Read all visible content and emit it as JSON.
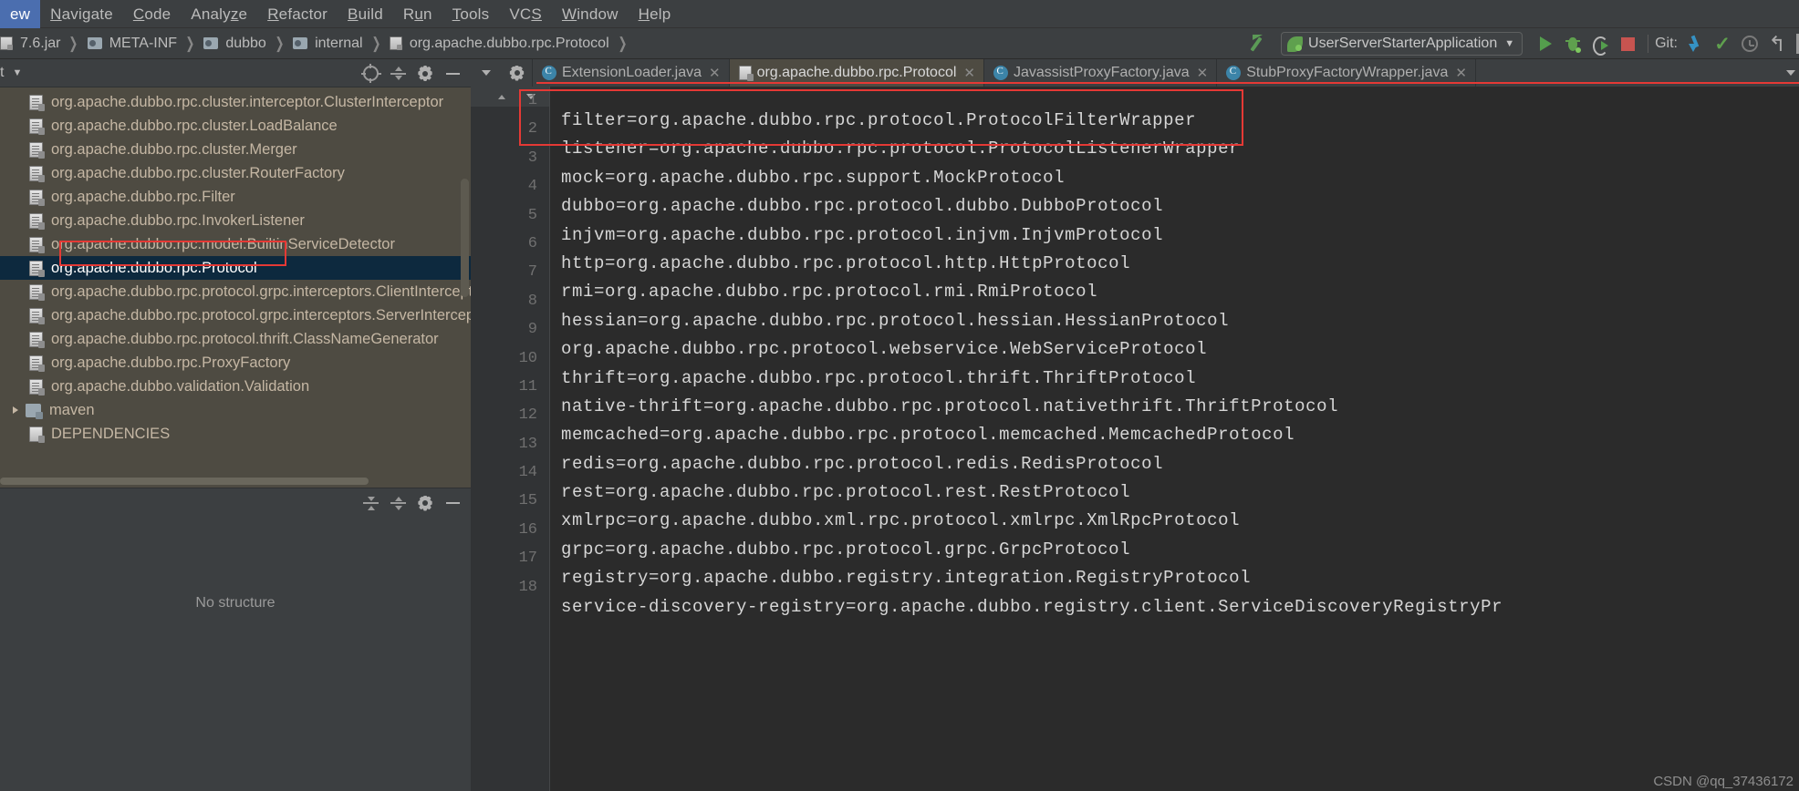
{
  "menu": {
    "items": [
      {
        "label": "ew",
        "mnemonic": ""
      },
      {
        "label": "Navigate",
        "mnemonic": "N"
      },
      {
        "label": "Code",
        "mnemonic": "C"
      },
      {
        "label": "Analyze",
        "mnemonic": "z"
      },
      {
        "label": "Refactor",
        "mnemonic": "R"
      },
      {
        "label": "Build",
        "mnemonic": "B"
      },
      {
        "label": "Run",
        "mnemonic": "u"
      },
      {
        "label": "Tools",
        "mnemonic": "T"
      },
      {
        "label": "VCS",
        "mnemonic": "S"
      },
      {
        "label": "Window",
        "mnemonic": "W"
      },
      {
        "label": "Help",
        "mnemonic": "H"
      }
    ]
  },
  "breadcrumb": {
    "items": [
      {
        "label": "7.6.jar",
        "icon": "jar-icon"
      },
      {
        "label": "META-INF",
        "icon": "folder-icon"
      },
      {
        "label": "dubbo",
        "icon": "folder-icon"
      },
      {
        "label": "internal",
        "icon": "folder-icon"
      },
      {
        "label": "org.apache.dubbo.rpc.Protocol",
        "icon": "file-icon"
      }
    ]
  },
  "toolbar": {
    "run_config": "UserServerStarterApplication",
    "run_config_icon": "spring-leaf-icon",
    "run_label": "run-button",
    "debug_label": "debug-button",
    "coverage_label": "run-with-coverage-button",
    "stop_label": "stop-button",
    "git_label": "Git:",
    "git_update_label": "update-project-button",
    "git_commit_label": "commit-button",
    "git_history_label": "show-history-button",
    "git_revert_label": "rollback-button"
  },
  "project_panel": {
    "title": "t",
    "caret": "▾",
    "actions": [
      "target-icon",
      "collapse-all-icon",
      "gear-icon",
      "hide-icon"
    ],
    "tree": [
      {
        "label": "org.apache.dubbo.rpc.cluster.interceptor.ClusterInterceptor",
        "icon": "file-icon",
        "selected": false
      },
      {
        "label": "org.apache.dubbo.rpc.cluster.LoadBalance",
        "icon": "file-icon",
        "selected": false
      },
      {
        "label": "org.apache.dubbo.rpc.cluster.Merger",
        "icon": "file-icon",
        "selected": false
      },
      {
        "label": "org.apache.dubbo.rpc.cluster.RouterFactory",
        "icon": "file-icon",
        "selected": false
      },
      {
        "label": "org.apache.dubbo.rpc.Filter",
        "icon": "file-icon",
        "selected": false
      },
      {
        "label": "org.apache.dubbo.rpc.InvokerListener",
        "icon": "file-icon",
        "selected": false
      },
      {
        "label": "org.apache.dubbo.rpc.model.BuiltinServiceDetector",
        "icon": "file-icon",
        "selected": false
      },
      {
        "label": "org.apache.dubbo.rpc.Protocol",
        "icon": "file-icon",
        "selected": true
      },
      {
        "label": "org.apache.dubbo.rpc.protocol.grpc.interceptors.ClientIntercept",
        "icon": "file-icon",
        "selected": false
      },
      {
        "label": "org.apache.dubbo.rpc.protocol.grpc.interceptors.ServerIntercept",
        "icon": "file-icon",
        "selected": false
      },
      {
        "label": "org.apache.dubbo.rpc.protocol.thrift.ClassNameGenerator",
        "icon": "file-icon",
        "selected": false
      },
      {
        "label": "org.apache.dubbo.rpc.ProxyFactory",
        "icon": "file-icon",
        "selected": false
      },
      {
        "label": "org.apache.dubbo.validation.Validation",
        "icon": "file-icon",
        "selected": false
      },
      {
        "label": "maven",
        "icon": "maven-folder-icon",
        "selected": false,
        "expandable": true
      },
      {
        "label": "DEPENDENCIES",
        "icon": "file-icon",
        "selected": false
      }
    ]
  },
  "structure_panel": {
    "empty_text": "No structure",
    "actions": [
      "expand-all-icon",
      "collapse-all-icon",
      "gear-icon",
      "hide-icon"
    ]
  },
  "editor_tabs": [
    {
      "label": "ExtensionLoader.java",
      "icon": "java-class-icon",
      "active": false
    },
    {
      "label": "org.apache.dubbo.rpc.Protocol",
      "icon": "file-icon",
      "active": true
    },
    {
      "label": "JavassistProxyFactory.java",
      "icon": "java-class-icon",
      "active": false
    },
    {
      "label": "StubProxyFactoryWrapper.java",
      "icon": "java-class-icon",
      "active": false
    }
  ],
  "editor": {
    "lines": [
      {
        "n": "1",
        "text": "filter=org.apache.dubbo.rpc.protocol.ProtocolFilterWrapper"
      },
      {
        "n": "2",
        "text": "listener=org.apache.dubbo.rpc.protocol.ProtocolListenerWrapper"
      },
      {
        "n": "3",
        "text": "mock=org.apache.dubbo.rpc.support.MockProtocol"
      },
      {
        "n": "4",
        "text": "dubbo=org.apache.dubbo.rpc.protocol.dubbo.DubboProtocol"
      },
      {
        "n": "5",
        "text": "injvm=org.apache.dubbo.rpc.protocol.injvm.InjvmProtocol"
      },
      {
        "n": "6",
        "text": "http=org.apache.dubbo.rpc.protocol.http.HttpProtocol"
      },
      {
        "n": "7",
        "text": "rmi=org.apache.dubbo.rpc.protocol.rmi.RmiProtocol"
      },
      {
        "n": "8",
        "text": "hessian=org.apache.dubbo.rpc.protocol.hessian.HessianProtocol"
      },
      {
        "n": "9",
        "text": "org.apache.dubbo.rpc.protocol.webservice.WebServiceProtocol"
      },
      {
        "n": "10",
        "text": "thrift=org.apache.dubbo.rpc.protocol.thrift.ThriftProtocol"
      },
      {
        "n": "11",
        "text": "native-thrift=org.apache.dubbo.rpc.protocol.nativethrift.ThriftProtocol"
      },
      {
        "n": "12",
        "text": "memcached=org.apache.dubbo.rpc.protocol.memcached.MemcachedProtocol"
      },
      {
        "n": "13",
        "text": "redis=org.apache.dubbo.rpc.protocol.redis.RedisProtocol"
      },
      {
        "n": "14",
        "text": "rest=org.apache.dubbo.rpc.protocol.rest.RestProtocol"
      },
      {
        "n": "15",
        "text": "xmlrpc=org.apache.dubbo.xml.rpc.protocol.xmlrpc.XmlRpcProtocol"
      },
      {
        "n": "16",
        "text": "grpc=org.apache.dubbo.rpc.protocol.grpc.GrpcProtocol"
      },
      {
        "n": "17",
        "text": "registry=org.apache.dubbo.registry.integration.RegistryProtocol"
      },
      {
        "n": "18",
        "text": "service-discovery-registry=org.apache.dubbo.registry.client.ServiceDiscoveryRegistryPr"
      }
    ]
  },
  "watermark": "CSDN @qq_37436172"
}
